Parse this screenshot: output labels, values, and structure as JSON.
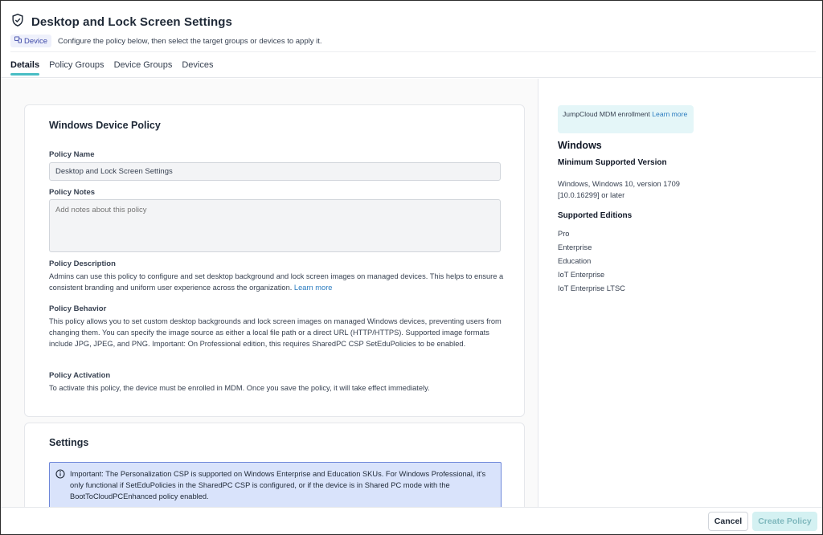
{
  "header": {
    "title": "Desktop and Lock Screen Settings",
    "badge": "Device",
    "subtitle": "Configure the policy below, then select the target groups or devices to apply it.",
    "tabs": [
      {
        "label": "Details",
        "active": true
      },
      {
        "label": "Policy Groups",
        "active": false
      },
      {
        "label": "Device Groups",
        "active": false
      },
      {
        "label": "Devices",
        "active": false
      }
    ]
  },
  "policy_card": {
    "title": "Windows Device Policy",
    "name_label": "Policy Name",
    "name_value": "Desktop and Lock Screen Settings",
    "notes_label": "Policy Notes",
    "notes_placeholder": "Add notes about this policy",
    "description_label": "Policy Description",
    "description_text": "Admins can use this policy to configure and set desktop background and lock screen images on managed devices. This helps to ensure a consistent branding and uniform user experience across the organization. ",
    "description_link": "Learn more",
    "behavior_label": "Policy Behavior",
    "behavior_text": "This policy allows you to set custom desktop backgrounds and lock screen images on managed Windows devices, preventing users from changing them. You can specify the image source as either a local file path or a direct URL (HTTP/HTTPS). Supported image formats include JPG, JPEG, and PNG. Important: On Professional edition, this requires SharedPC CSP SetEduPolicies to be enabled.",
    "activation_label": "Policy Activation",
    "activation_text": "To activate this policy, the device must be enrolled in MDM. Once you save the policy, it will take effect immediately."
  },
  "settings_card": {
    "title": "Settings",
    "notice": "Important: The Personalization CSP is supported on Windows Enterprise and Education SKUs. For Windows Professional, it's only functional if SetEduPolicies in the SharedPC CSP is configured, or if the device is in Shared PC mode with the BootToCloudPCEnhanced policy enabled."
  },
  "sidebar": {
    "mdm_text": "JumpCloud MDM enrollment ",
    "mdm_link": "Learn more",
    "os": "Windows",
    "min_version_label": "Minimum Supported Version",
    "min_version_value": "Windows, Windows 10, version 1709 [10.0.16299] or later",
    "editions_label": "Supported Editions",
    "editions": [
      "Pro",
      "Enterprise",
      "Education",
      "IoT Enterprise",
      "IoT Enterprise LTSC"
    ]
  },
  "footer": {
    "cancel_label": "Cancel",
    "create_label": "Create Policy"
  },
  "colors": {
    "accent": "#48bdc4",
    "link": "#2a7bbf",
    "badge_bg": "#eef0fb",
    "notice_bg": "#d9e3fb",
    "mdm_bg": "#e4f6f8",
    "create_disabled_bg": "#d4f1f2"
  },
  "icons": {
    "title_icon": "shield-check-icon",
    "badge_icon": "devices-icon",
    "notice_icon": "info-circle-icon"
  }
}
